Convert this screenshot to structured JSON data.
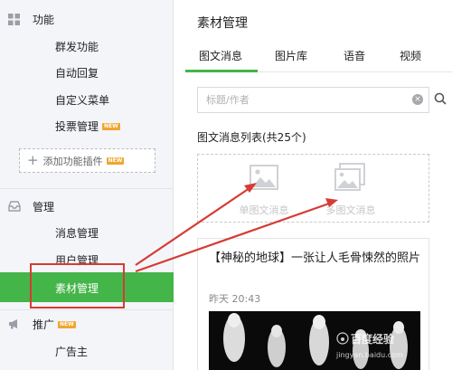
{
  "sidebar": {
    "function_section": {
      "title": "功能",
      "items": [
        {
          "label": "群发功能"
        },
        {
          "label": "自动回复"
        },
        {
          "label": "自定义菜单"
        },
        {
          "label": "投票管理",
          "badge": "NEW"
        }
      ],
      "add_plugin": {
        "label": "添加功能插件",
        "badge": "NEW"
      }
    },
    "manage_section": {
      "title": "管理",
      "items": [
        {
          "label": "消息管理"
        },
        {
          "label": "用户管理"
        },
        {
          "label": "素材管理",
          "active": true
        }
      ]
    },
    "promo_section": {
      "title": "推广",
      "badge": "NEW",
      "items": [
        {
          "label": "广告主"
        }
      ]
    }
  },
  "main": {
    "title": "素材管理",
    "tabs": [
      {
        "label": "图文消息",
        "active": true
      },
      {
        "label": "图片库"
      },
      {
        "label": "语音"
      },
      {
        "label": "视频"
      }
    ],
    "search": {
      "placeholder": "标题/作者",
      "value": ""
    },
    "list_count": "图文消息列表(共25个)",
    "create": {
      "single_label": "单图文消息",
      "multi_label": "多图文消息"
    },
    "card": {
      "title": "【神秘的地球】一张让人毛骨悚然的照片",
      "time": "昨天 20:43"
    }
  },
  "watermark": {
    "main": "百度经验",
    "sub": "jingyan.baidu.com"
  },
  "colors": {
    "accent_green": "#44b549",
    "annotation_red": "#d63b33",
    "badge_orange": "#f0a62f",
    "sidebar_bg": "#f4f5f9"
  },
  "icons": {
    "function": "grid-icon",
    "manage": "inbox-icon",
    "promo": "megaphone-icon",
    "search": "search-icon",
    "clear": "clear-icon",
    "image_placeholder": "image-icon"
  }
}
